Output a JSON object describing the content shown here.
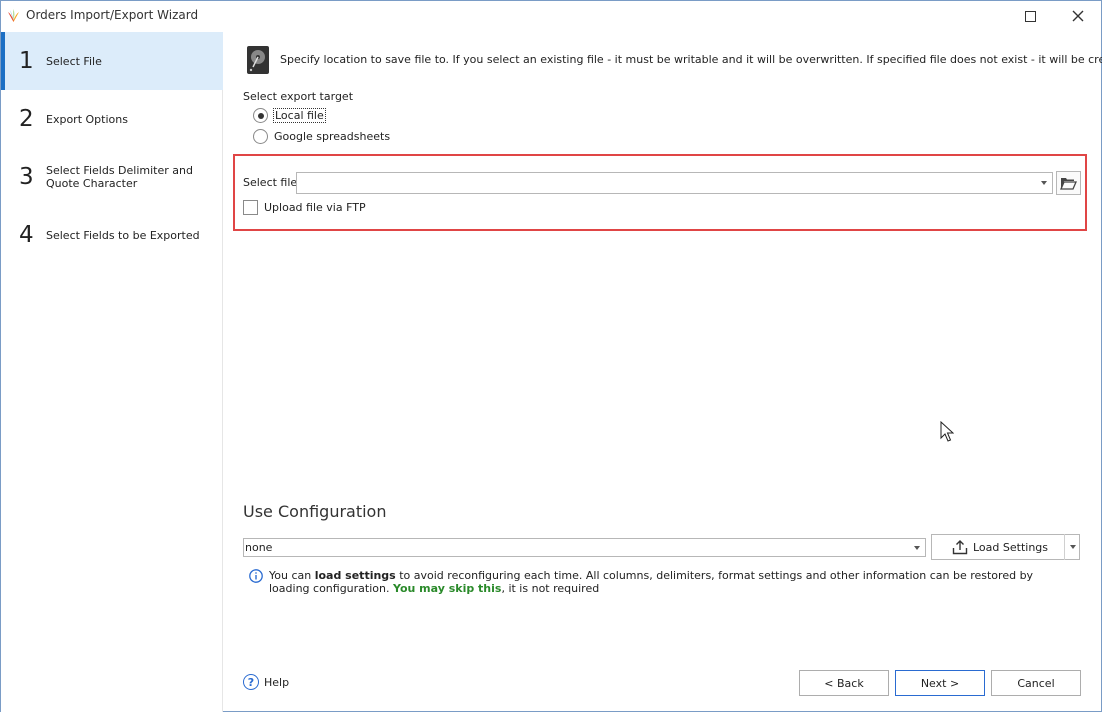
{
  "window": {
    "title": "Orders Import/Export Wizard"
  },
  "steps": [
    {
      "number": "1",
      "label": "Select File",
      "active": true
    },
    {
      "number": "2",
      "label": "Export Options",
      "active": false
    },
    {
      "number": "3",
      "label": "Select Fields Delimiter and Quote Character",
      "active": false
    },
    {
      "number": "4",
      "label": "Select Fields to be Exported",
      "active": false
    }
  ],
  "main": {
    "intro": "Specify location to save file to. If you select an existing file - it must be writable and it will be overwritten. If specified file does not exist - it will be created.",
    "target_label": "Select export target",
    "targets": [
      {
        "label": "Local file",
        "checked": true
      },
      {
        "label": "Google spreadsheets",
        "checked": false
      }
    ],
    "file_label": "Select file",
    "file_value": "",
    "ftp_label": "Upload file via FTP",
    "ftp_checked": false
  },
  "config": {
    "title": "Use Configuration",
    "value": "none",
    "load_button": "Load Settings",
    "info_prefix": "You can ",
    "info_bold": "load settings",
    "info_middle": " to avoid reconfiguring each time. All columns, delimiters, format settings and other information can be restored by loading configuration. ",
    "info_green": "You may skip this",
    "info_suffix": ", it is not required"
  },
  "footer": {
    "help": "Help",
    "back": "< Back",
    "next": "Next >",
    "cancel": "Cancel"
  },
  "colors": {
    "accent": "#1c6fc4",
    "active_step_bg": "#dcecfa",
    "highlight": "#e04545",
    "skip_text": "#2a8a2a"
  }
}
